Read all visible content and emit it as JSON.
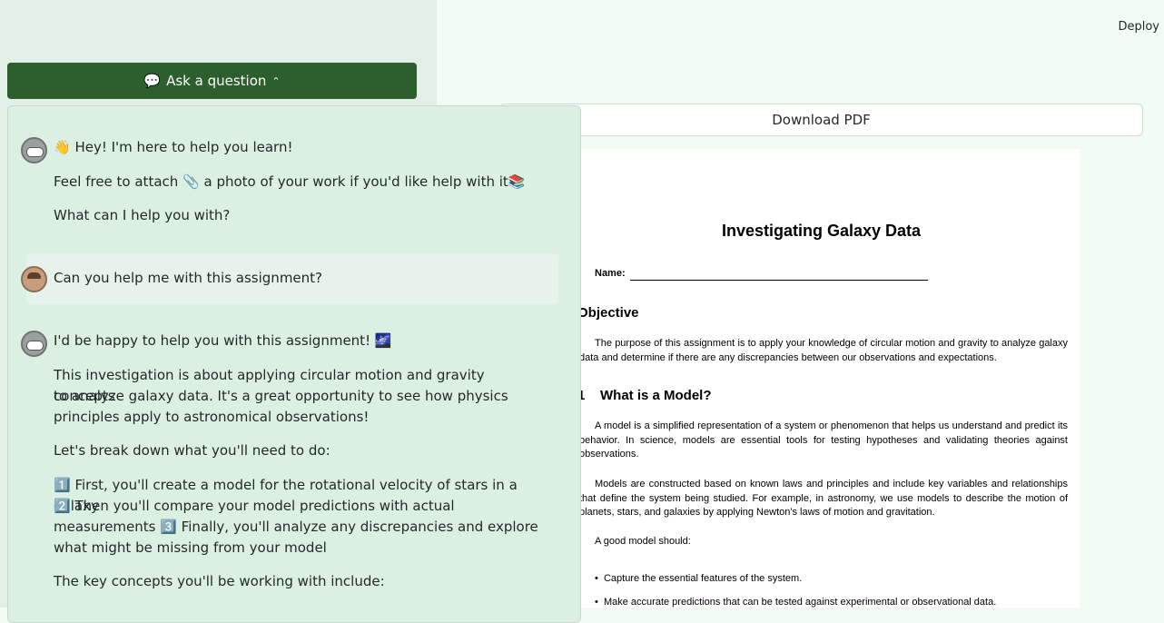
{
  "sidebar": {
    "ask_button": {
      "icon": "💬",
      "label": "Ask a question",
      "chevron": "⌃"
    }
  },
  "header": {
    "deploy": "Deploy"
  },
  "download": {
    "label": "Download PDF"
  },
  "pdf": {
    "title": "Investigating Galaxy Data",
    "name_label": "Name:",
    "objective_heading": "Objective",
    "objective_text": "The purpose of this assignment is to apply your knowledge of circular motion and gravity to analyze galaxy data and determine if there are any discrepancies between our observations and expectations.",
    "section_number": "1",
    "model_heading": "What is a Model?",
    "model_p1": "A model is a simplified representation of a system or phenomenon that helps us understand and predict its behavior. In science, models are essential tools for testing hypotheses and validating theories against observations.",
    "model_p2": "Models are constructed based on known laws and principles and include key variables and relationships that define the system being studied. For example, in astronomy, we use models to describe the motion of planets, stars, and galaxies by applying Newton's laws of motion and gravitation.",
    "good_model": "A good model should:",
    "bullets": [
      "Capture the essential features of the system.",
      "Make accurate predictions that can be tested against experimental or observational data."
    ]
  },
  "chat": {
    "messages": [
      {
        "role": "assistant",
        "lines": [
          "👋 Hey! I'm here to help you learn!",
          "Feel free to attach 📎 a photo of your work if you'd like help with it📚",
          "What can I help you with?"
        ]
      },
      {
        "role": "user",
        "lines": [
          "Can you help me with this assignment?"
        ]
      },
      {
        "role": "assistant",
        "lines": [
          "I'd be happy to help you with this assignment! 🌌",
          "This investigation is about applying circular motion and gravity concepts",
          "to analyze galaxy data. It's a great opportunity to see how physics",
          "principles apply to astronomical observations!",
          "Let's break down what you'll need to do:",
          "1️⃣ First, you'll create a model for the rotational velocity of stars in a galaxy",
          "2️⃣ Then you'll compare your model predictions with actual",
          "measurements 3️⃣ Finally, you'll analyze any discrepancies and explore",
          "what might be missing from your model",
          "The key concepts you'll be working with include:"
        ]
      }
    ]
  }
}
